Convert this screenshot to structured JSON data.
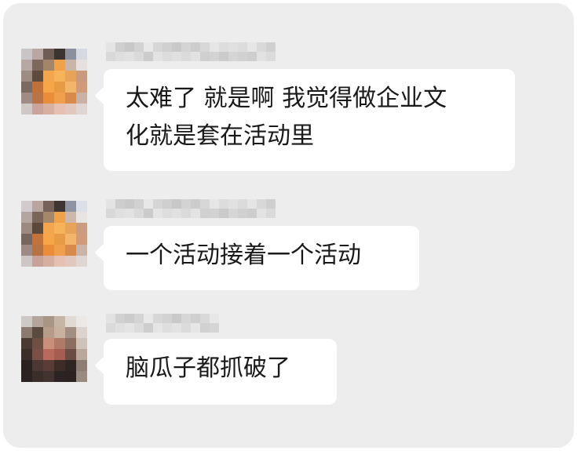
{
  "colors": {
    "panel_background": "#ededed",
    "bubble_background": "#ffffff",
    "text": "#191919"
  },
  "messages": [
    {
      "sender_icon": "blurred-avatar-icon",
      "text": "太难了 就是啊 我觉得做企业文\n化就是套在活动里"
    },
    {
      "sender_icon": "blurred-avatar-icon",
      "text": "一个活动接着一个活动"
    },
    {
      "sender_icon": "blurred-avatar-icon",
      "text": "脑瓜子都抓破了"
    }
  ]
}
